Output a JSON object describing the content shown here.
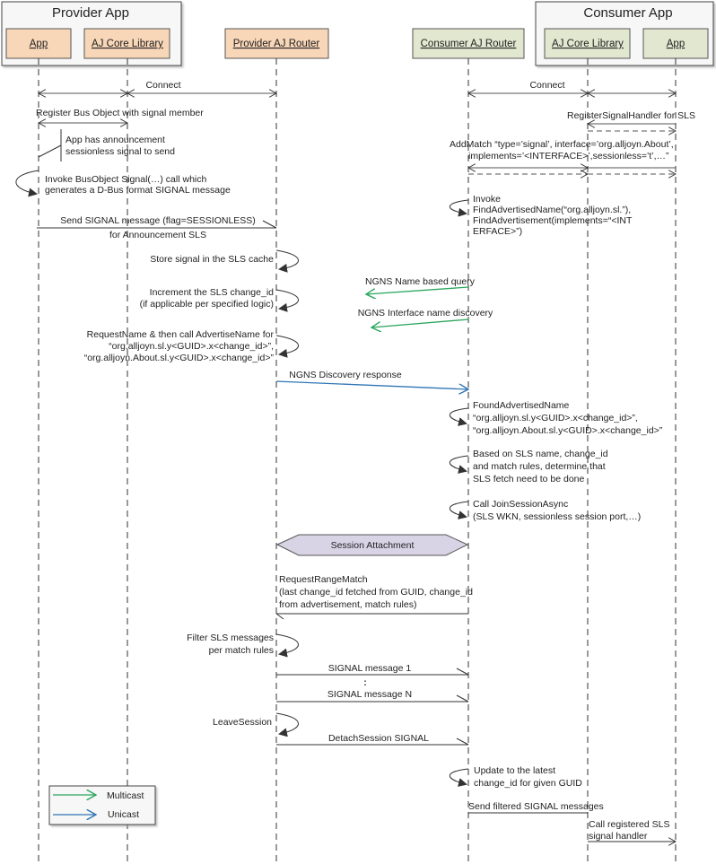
{
  "groups": {
    "provider": "Provider App",
    "consumer": "Consumer App"
  },
  "participants": [
    {
      "id": "papp",
      "label": "App",
      "color": "#f8d6b8"
    },
    {
      "id": "pcore",
      "label": "AJ Core Library",
      "color": "#f8d6b8"
    },
    {
      "id": "prouter",
      "label": "Provider AJ Router",
      "color": "#f8d6b8"
    },
    {
      "id": "crouter",
      "label": "Consumer AJ Router",
      "color": "#e2e8d0"
    },
    {
      "id": "ccore",
      "label": "AJ Core Library",
      "color": "#e2e8d0"
    },
    {
      "id": "capp",
      "label": "App",
      "color": "#e2e8d0"
    }
  ],
  "messages": {
    "connect_provider": "Connect",
    "connect_consumer": "Connect",
    "register_bus_object": "Register Bus Object with signal member",
    "note_announcement": [
      "App has announcement",
      "sessionless signal to send"
    ],
    "invoke_busobject": [
      "Invoke BusObject Signal(…) call which",
      "generates a D-Bus format SIGNAL message"
    ],
    "send_signal": [
      "Send SIGNAL message (flag=SESSIONLESS)",
      "for Announcement SLS"
    ],
    "register_signal_handler": "RegisterSignalHandler for SLS",
    "add_match": [
      "AddMatch “type=’signal’, interface=’org.alljoyn.About’,",
      "implements=’<INTERFACE>’,sessionless=’t’,…”"
    ],
    "invoke_find": [
      "Invoke",
      "FindAdvertisedName(“org.alljoyn.sl.”),",
      "FindAdvertisement(implements=“<INT",
      "ERFACE>”)"
    ],
    "store_signal": "Store signal in the SLS cache",
    "increment_change_id": [
      "Increment the SLS change_id",
      "(if applicable per specified logic)"
    ],
    "ngns_name_query": "NGNS Name based query",
    "ngns_interface_discovery": "NGNS Interface name discovery",
    "request_name": [
      "RequestName & then call AdvertiseName for",
      "“org.alljoyn.sl.y<GUID>.x<change_id>”,",
      "“org.alljoyn.About.sl.y<GUID>.x<change_id>”"
    ],
    "ngns_discovery_response": "NGNS Discovery response",
    "found_advertised": [
      "FoundAdvertisedName",
      "“org.alljoyn.sl.y<GUID>.x<change_id>”,",
      "“org.alljoyn.About.sl.y<GUID>.x<change_id>”"
    ],
    "based_on_sls": [
      "Based on SLS name, change_id",
      "and match rules, determine that",
      "SLS fetch need to be done"
    ],
    "join_session": [
      "Call JoinSessionAsync",
      "(SLS WKN, sessionless session port,…)"
    ],
    "session_attachment": "Session Attachment",
    "request_range_match": [
      "RequestRangeMatch",
      "(last change_id fetched from GUID, change_id",
      "from advertisement, match rules)"
    ],
    "filter_sls": [
      "Filter SLS messages",
      "per match rules"
    ],
    "signal_1": "SIGNAL message 1",
    "ellipsis": ":",
    "signal_n": "SIGNAL message N",
    "leave_session": "LeaveSession",
    "detach_session": "DetachSession SIGNAL",
    "update_change_id": [
      "Update to the latest",
      "change_id for given GUID"
    ],
    "send_filtered": "Send filtered SIGNAL messages",
    "call_handler": [
      "Call registered SLS",
      "signal handler"
    ]
  },
  "legend": {
    "items": [
      {
        "label": "Multicast",
        "color": "#2aa65c"
      },
      {
        "label": "Unicast",
        "color": "#2f75b5"
      }
    ]
  },
  "colors": {
    "provider_box": "#f8d6b8",
    "consumer_box": "#e2e8d0",
    "session_box": "#d9d3e6",
    "line": "#333333",
    "multicast": "#2aa65c",
    "unicast": "#2f75b5"
  }
}
